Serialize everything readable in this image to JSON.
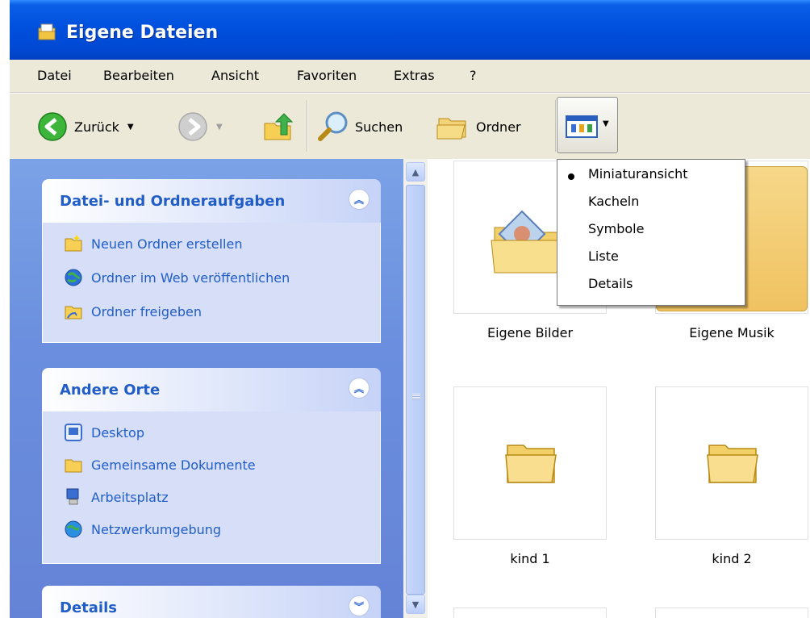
{
  "window": {
    "title": "Eigene Dateien"
  },
  "menubar": {
    "items": [
      "Datei",
      "Bearbeiten",
      "Ansicht",
      "Favoriten",
      "Extras",
      "?"
    ]
  },
  "toolbar": {
    "back_label": "Zurück",
    "search_label": "Suchen",
    "folders_label": "Ordner"
  },
  "view_menu": {
    "options": [
      "Miniaturansicht",
      "Kacheln",
      "Symbole",
      "Liste",
      "Details"
    ],
    "selected": "Miniaturansicht"
  },
  "tasks_panel": {
    "title": "Datei- und Ordneraufgaben",
    "links": [
      "Neuen Ordner erstellen",
      "Ordner im Web veröffentlichen",
      "Ordner freigeben"
    ]
  },
  "places_panel": {
    "title": "Andere Orte",
    "links": [
      "Desktop",
      "Gemeinsame Dokumente",
      "Arbeitsplatz",
      "Netzwerkumgebung"
    ]
  },
  "details_panel": {
    "title": "Details"
  },
  "items": [
    {
      "label": "Eigene Bilder"
    },
    {
      "label": "Eigene Musik"
    },
    {
      "label": "kind 1"
    },
    {
      "label": "kind 2"
    }
  ],
  "colors": {
    "title_bar": "#0050de",
    "task_pane": "#6b8fde",
    "link": "#215dc6"
  }
}
